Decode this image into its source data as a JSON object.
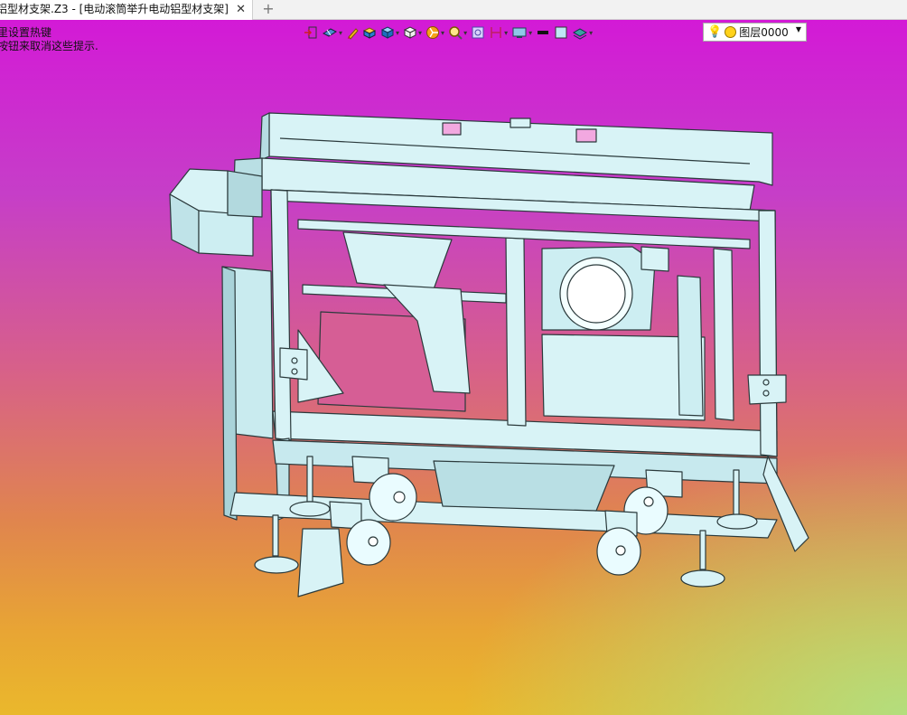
{
  "tab": {
    "title": "铝型材支架.Z3 - [电动滚筒举升电动铝型材支架]",
    "close_glyph": "✕",
    "new_glyph": "+"
  },
  "hints": [
    "里设置热键",
    "按钮来取消这些提示."
  ],
  "toolbar": {
    "icons": [
      "import-icon",
      "view-orient-icon",
      "pen-icon",
      "part-color-icon",
      "shaded-box-icon",
      "wire-box-icon",
      "render-mode-icon",
      "zoom-icon",
      "fit-view-icon",
      "section-icon",
      "display-settings-icon",
      "line-color-icon",
      "fill-color-icon",
      "layer-stack-icon"
    ],
    "layer": {
      "name": "图层0000",
      "status_icon": "lightbulb-icon"
    }
  },
  "colors": {
    "tab_bg": "#f2f2f2",
    "model_fill": "#d8f3f6",
    "model_edge": "#2b3a3c",
    "bg_top": "#d31ad6",
    "bg_bottom": "#eab82c",
    "bg_corner": "#b0e082"
  }
}
